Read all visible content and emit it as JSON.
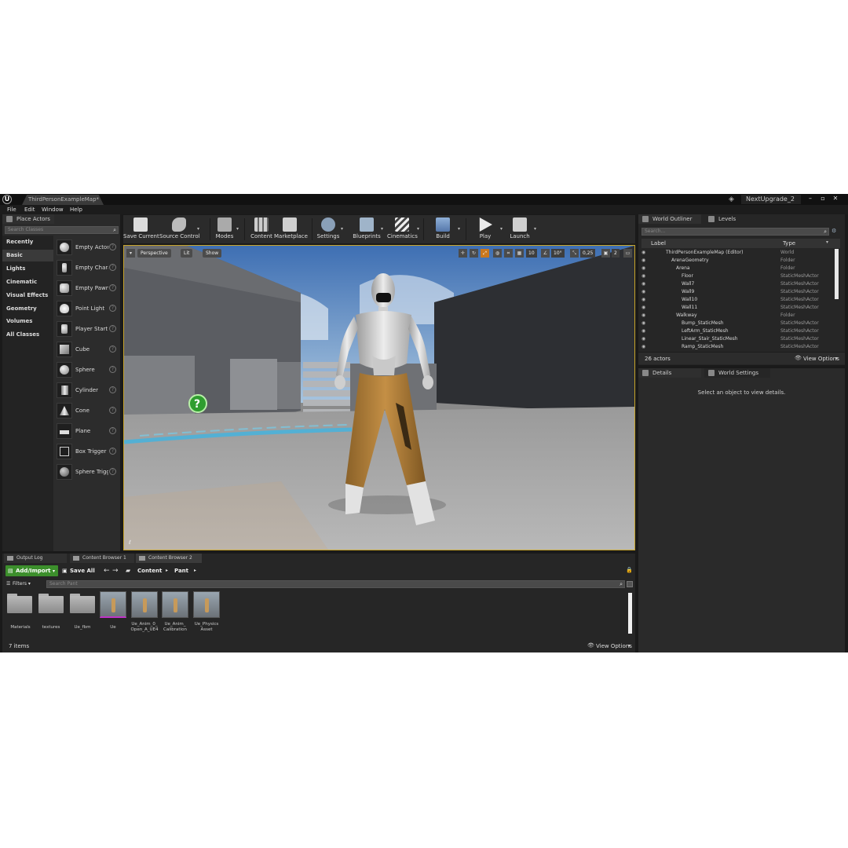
{
  "window": {
    "map_tab": "ThirdPersonExampleMap*",
    "project_name": "NextUpgrade_2"
  },
  "menu": [
    "File",
    "Edit",
    "Window",
    "Help"
  ],
  "place_actors": {
    "tab_label": "Place Actors",
    "search_placeholder": "Search Classes",
    "categories": [
      "Recently Placed",
      "Basic",
      "Lights",
      "Cinematic",
      "Visual Effects",
      "Geometry",
      "Volumes",
      "All Classes"
    ],
    "selected_category": "Basic",
    "actors": [
      "Empty Actor",
      "Empty Chara",
      "Empty Pawn",
      "Point Light",
      "Player Start",
      "Cube",
      "Sphere",
      "Cylinder",
      "Cone",
      "Plane",
      "Box Trigger",
      "Sphere Trigg"
    ]
  },
  "toolbar": {
    "save_current": "Save Current",
    "source_control": "Source Control",
    "modes": "Modes",
    "content": "Content",
    "marketplace": "Marketplace",
    "settings": "Settings",
    "blueprints": "Blueprints",
    "cinematics": "Cinematics",
    "build": "Build",
    "play": "Play",
    "launch": "Launch"
  },
  "viewport": {
    "perspective": "Perspective",
    "lit": "Lit",
    "show": "Show",
    "grid_snap": "10",
    "rotation_snap": "10°",
    "scale_snap": "0,25",
    "camera_speed": "2"
  },
  "outliner": {
    "tab_world_outliner": "World Outliner",
    "tab_levels": "Levels",
    "search_placeholder": "Search...",
    "col_label": "Label",
    "col_type": "Type",
    "rows": [
      {
        "label": "ThirdPersonExampleMap (Editor)",
        "type": "World"
      },
      {
        "label": "ArenaGeometry",
        "type": "Folder"
      },
      {
        "label": "Arena",
        "type": "Folder"
      },
      {
        "label": "Floor",
        "type": "StaticMeshActor"
      },
      {
        "label": "Wall7",
        "type": "StaticMeshActor"
      },
      {
        "label": "Wall9",
        "type": "StaticMeshActor"
      },
      {
        "label": "Wall10",
        "type": "StaticMeshActor"
      },
      {
        "label": "Wall11",
        "type": "StaticMeshActor"
      },
      {
        "label": "Walkway",
        "type": "Folder"
      },
      {
        "label": "Bump_StaticMesh",
        "type": "StaticMeshActor"
      },
      {
        "label": "LeftArm_StaticMesh",
        "type": "StaticMeshActor"
      },
      {
        "label": "Linear_Stair_StaticMesh",
        "type": "StaticMeshActor"
      },
      {
        "label": "Ramp_StaticMesh",
        "type": "StaticMeshActor"
      }
    ],
    "actor_count": "26 actors",
    "view_options": "View Options"
  },
  "details": {
    "tab_details": "Details",
    "tab_world_settings": "World Settings",
    "empty_message": "Select an object to view details."
  },
  "content_browser": {
    "tabs": [
      "Output Log",
      "Content Browser 1",
      "Content Browser 2"
    ],
    "add_import": "Add/Import",
    "save_all": "Save All",
    "path": [
      "Content",
      "Pant"
    ],
    "filters": "Filters",
    "search_placeholder": "Search Pant",
    "folders": [
      "Materials",
      "textures",
      "Ue_fbm"
    ],
    "assets": [
      {
        "label": "Ue"
      },
      {
        "label": "Ue_Anim_0_\nOpen_A_UE4"
      },
      {
        "label": "Ue_Anim_\nCalibration"
      },
      {
        "label": "Ue_Physics\nAsset"
      }
    ],
    "item_count": "7 items",
    "view_options": "View Options"
  },
  "colors": {
    "viewport_border": "#c7a42a",
    "add_import_green": "#3c8f2c",
    "selection_orange": "#c9771d"
  }
}
